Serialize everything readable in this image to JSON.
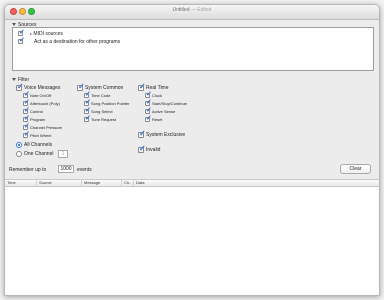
{
  "window": {
    "title": "Untitled",
    "subtitle": "— Edited"
  },
  "sources": {
    "heading": "Sources",
    "items": [
      {
        "label": "MIDI sources",
        "checked": true
      },
      {
        "label": "Act as a destination for other programs",
        "checked": true
      }
    ]
  },
  "filter": {
    "heading": "Filter",
    "voice_messages": {
      "label": "Voice Messages",
      "items": [
        "Note On/Off",
        "Aftertouch (Poly)",
        "Control",
        "Program",
        "Channel Pressure",
        "Pitch Wheel"
      ]
    },
    "system_common": {
      "label": "System Common",
      "items": [
        "Time Code",
        "Song Position Pointer",
        "Song Select",
        "Tune Request"
      ]
    },
    "real_time": {
      "label": "Real Time",
      "items": [
        "Clock",
        "Start/Stop/Continue",
        "Active Sense",
        "Reset"
      ]
    },
    "system_exclusive": "System Exclusive",
    "invalid": "Invalid",
    "channels": {
      "all_label": "All Channels",
      "one_label": "One Channel",
      "one_value": "1",
      "selected": "all"
    }
  },
  "remember": {
    "prefix": "Remember up to",
    "value": "1000",
    "suffix": "events"
  },
  "clear_button": "Clear",
  "table": {
    "columns": [
      "Time",
      "Source",
      "Message",
      "Ch...",
      "Data"
    ]
  },
  "colors": {
    "checkmark": "#2a6fd6",
    "close": "#fc5f57",
    "minimize": "#fdbc40",
    "zoom": "#33c748"
  }
}
